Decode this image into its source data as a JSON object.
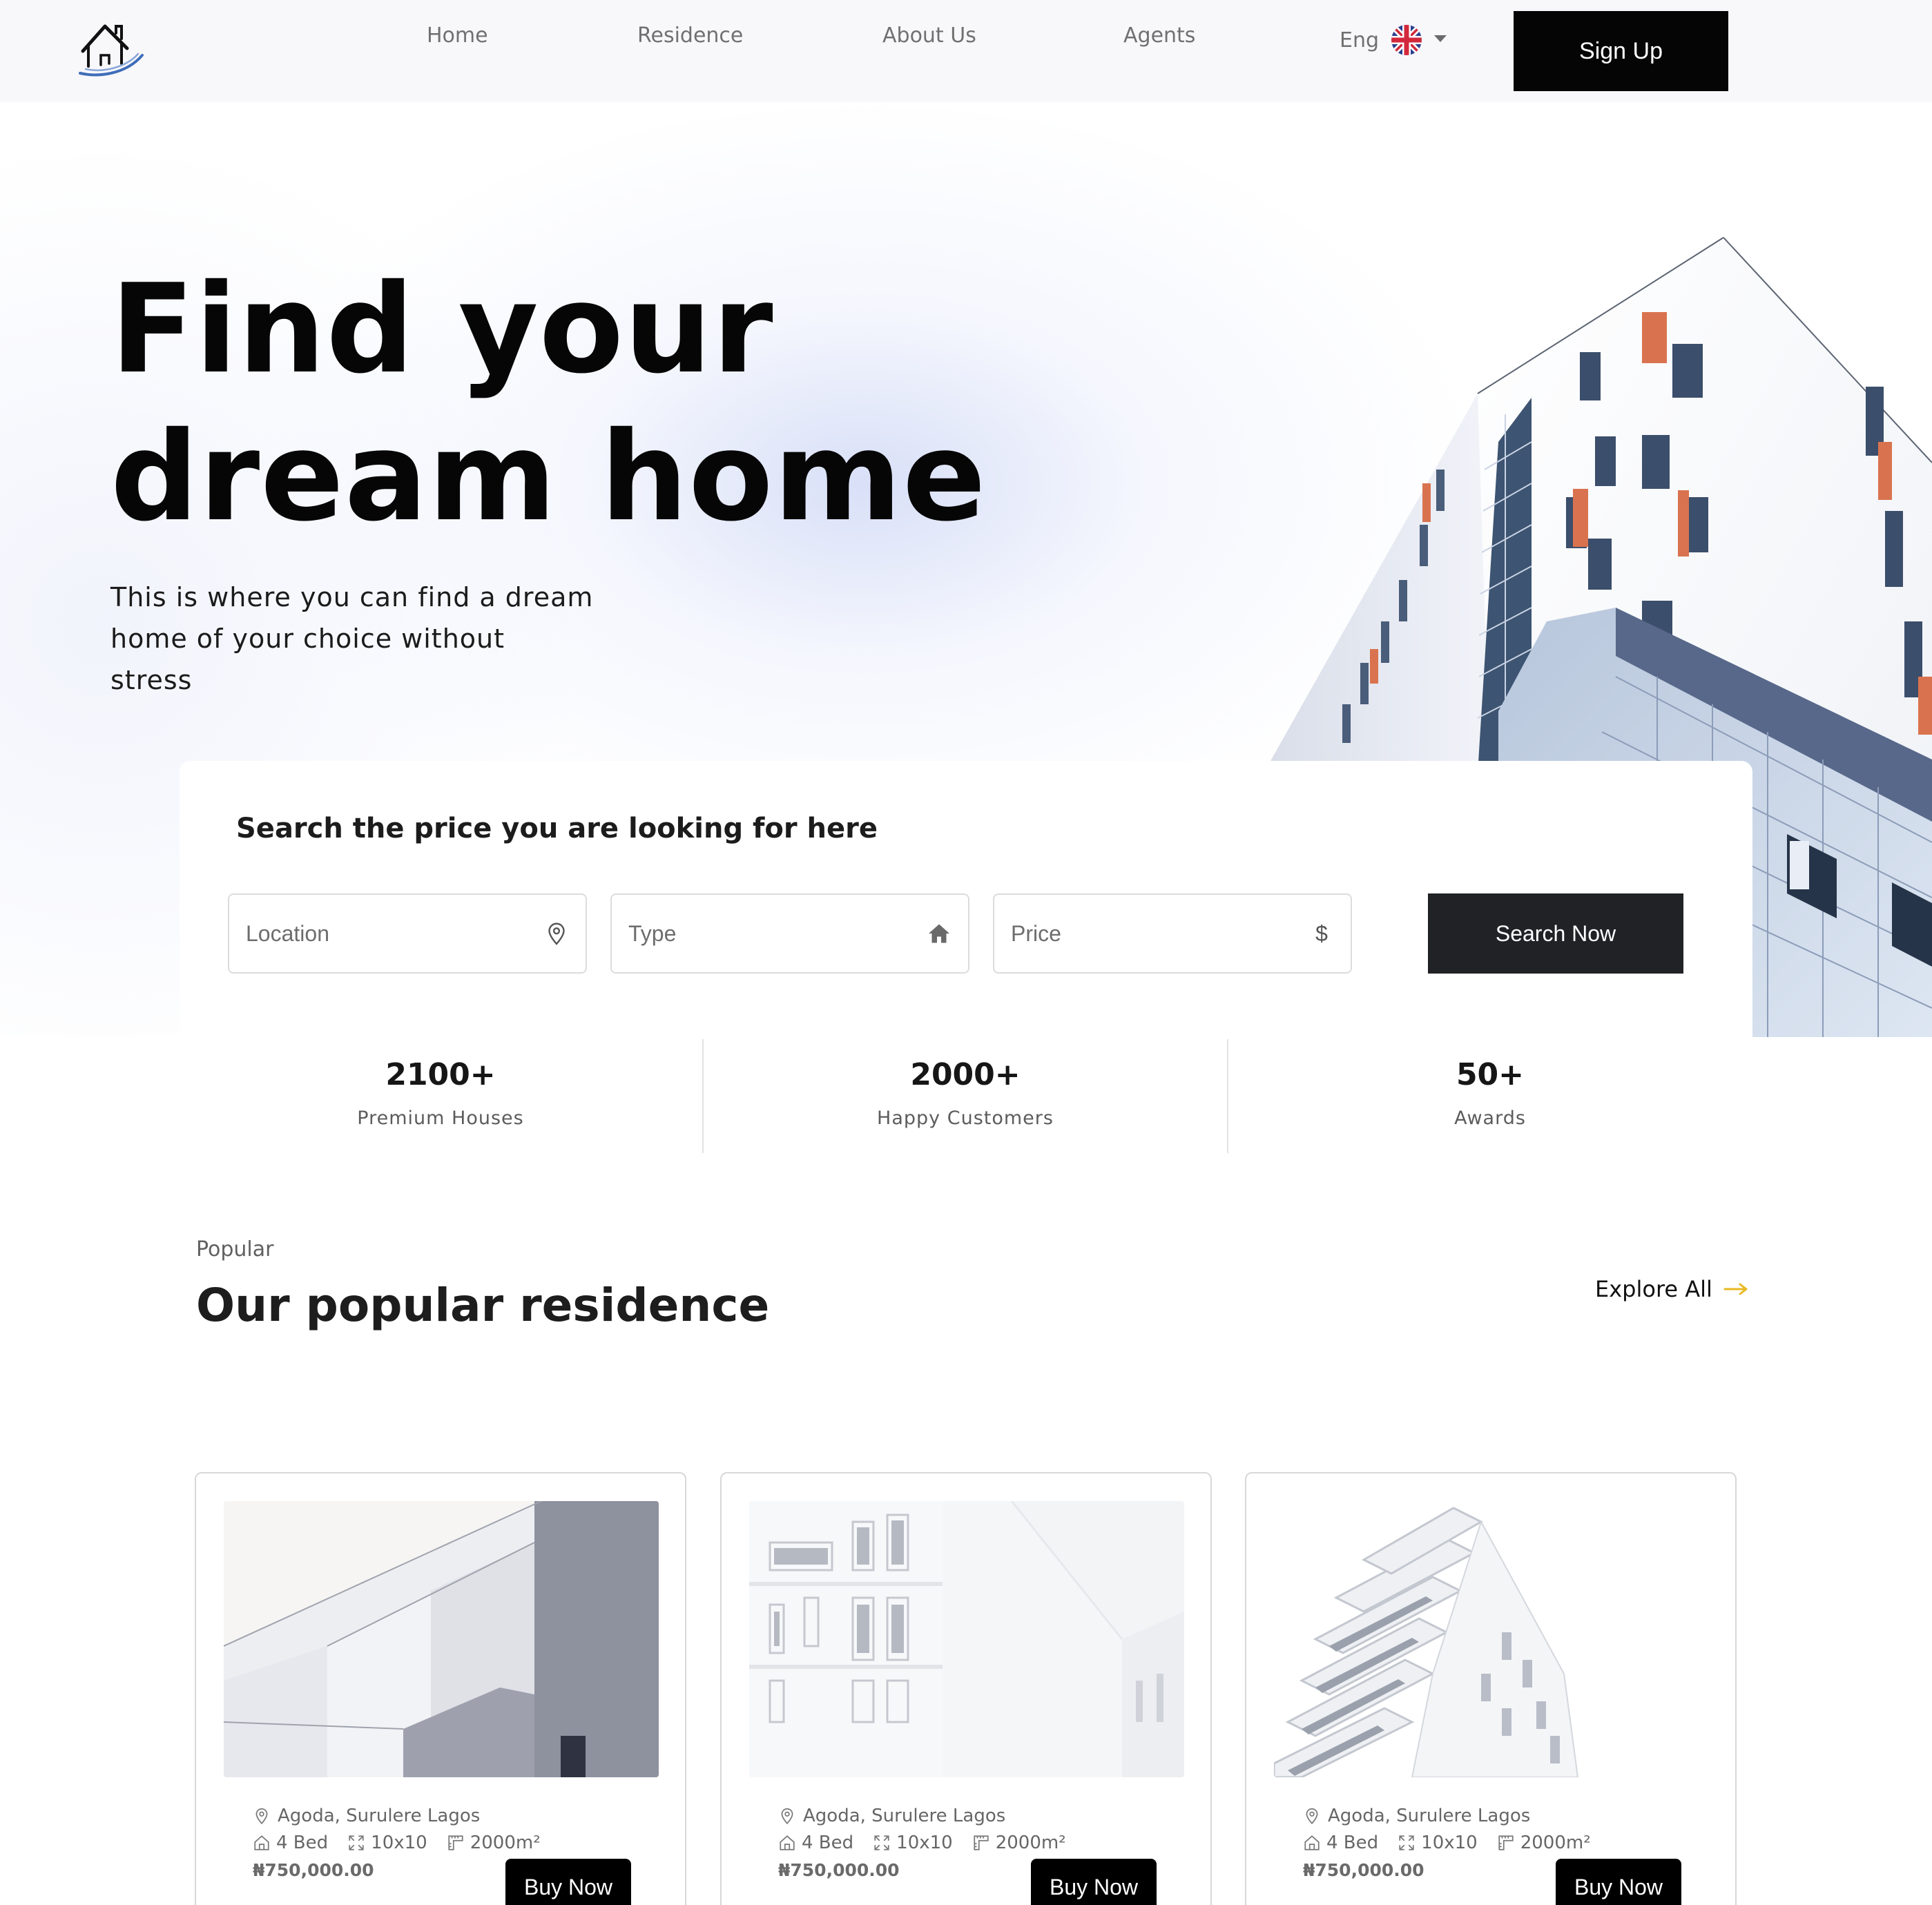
{
  "header": {
    "nav": [
      "Home",
      "Residence",
      "About Us",
      "Agents"
    ],
    "language": "Eng",
    "signup_label": "Sign Up"
  },
  "hero": {
    "title_line1": "Find your",
    "title_line2": "dream home",
    "subtitle": "This is where you can find a dream home of your choice without stress"
  },
  "search": {
    "title": "Search the price you are looking for here",
    "fields": [
      {
        "label": "Location",
        "icon": "map-pin-icon"
      },
      {
        "label": "Type",
        "icon": "home-icon"
      },
      {
        "label": "Price",
        "icon": "$"
      }
    ],
    "button_label": "Search Now"
  },
  "stats": [
    {
      "value": "2100+",
      "label": "Premium Houses"
    },
    {
      "value": "2000+",
      "label": "Happy Customers"
    },
    {
      "value": "50+",
      "label": "Awards"
    }
  ],
  "popular": {
    "eyebrow": "Popular",
    "title": "Our popular residence",
    "explore_label": "Explore All",
    "accent": "#e8b923"
  },
  "cards": [
    {
      "location": "Agoda, Surulere Lagos",
      "beds": "4 Bed",
      "size": "10x10",
      "area": "2000m²",
      "price": "₦750,000.00",
      "button": "Buy Now"
    },
    {
      "location": "Agoda, Surulere Lagos",
      "beds": "4 Bed",
      "size": "10x10",
      "area": "2000m²",
      "price": "₦750,000.00",
      "button": "Buy Now"
    },
    {
      "location": "Agoda, Surulere Lagos",
      "beds": "4 Bed",
      "size": "10x10",
      "area": "2000m²",
      "price": "₦750,000.00",
      "button": "Buy Now"
    }
  ]
}
